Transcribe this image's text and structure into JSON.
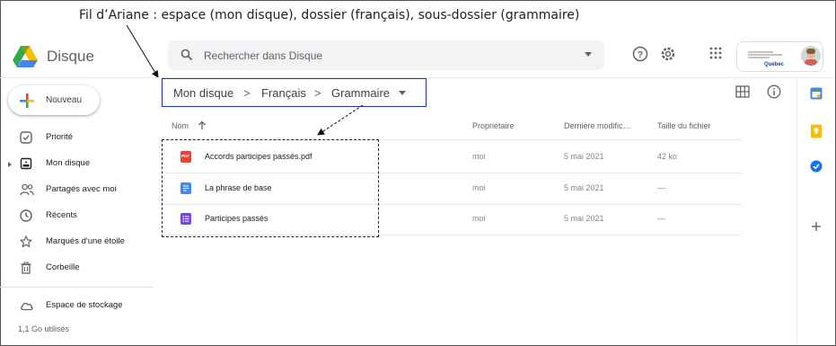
{
  "annotation": {
    "text": "Fil d’Ariane  : espace (mon disque), dossier (français), sous-dossier (grammaire)"
  },
  "app": {
    "title": "Disque",
    "logo": "google-drive-logo"
  },
  "search": {
    "placeholder": "Rechercher dans Disque",
    "icon": "search-icon"
  },
  "header_actions": {
    "icons": [
      "help-icon",
      "settings-icon",
      "apps-grid-icon"
    ],
    "org_logo_label": "Québec",
    "account_avatar": "avatar"
  },
  "sidebar": {
    "new_button": "Nouveau",
    "items": [
      {
        "label": "Priorité",
        "icon": "priority-checkbox-icon"
      },
      {
        "label": "Mon disque",
        "icon": "my-drive-icon"
      },
      {
        "label": "Partagés avec moi",
        "icon": "shared-people-icon"
      },
      {
        "label": "Récents",
        "icon": "clock-icon"
      },
      {
        "label": "Marqués d'une étoile",
        "icon": "star-icon"
      },
      {
        "label": "Corbeille",
        "icon": "trash-icon"
      }
    ],
    "storage": {
      "label": "Espace de stockage",
      "icon": "cloud-icon",
      "used": "1,1 Go utilisés"
    }
  },
  "breadcrumb": {
    "items": [
      "Mon disque",
      "Français",
      "Grammaire"
    ],
    "separator": ">"
  },
  "view_controls": [
    "grid-view-icon",
    "info-icon"
  ],
  "table": {
    "columns": [
      "Nom",
      "Propriétaire",
      "Dernière modific…",
      "Taille du fichier"
    ],
    "sort_icon": "arrow-up-icon",
    "rows": [
      {
        "name": "Accords participes passés.pdf",
        "type": "pdf",
        "type_label": "PDF",
        "owner": "moi",
        "modified": "5 mai 2021",
        "size": "42 ko"
      },
      {
        "name": "La phrase de base",
        "type": "doc",
        "owner": "moi",
        "modified": "5 mai 2021",
        "size": "—"
      },
      {
        "name": "Participes passés",
        "type": "form",
        "owner": "moi",
        "modified": "5 mai 2021",
        "size": "—"
      }
    ]
  },
  "right_rail": [
    "calendar-icon",
    "keep-icon",
    "tasks-icon",
    "add-icon"
  ],
  "colors": {
    "accent_blue": "#1a73e8",
    "breadcrumb_box": "#1a2fbf",
    "pdf_red": "#ea4335",
    "doc_blue": "#4285f4",
    "form_purple": "#7e3ff2"
  }
}
